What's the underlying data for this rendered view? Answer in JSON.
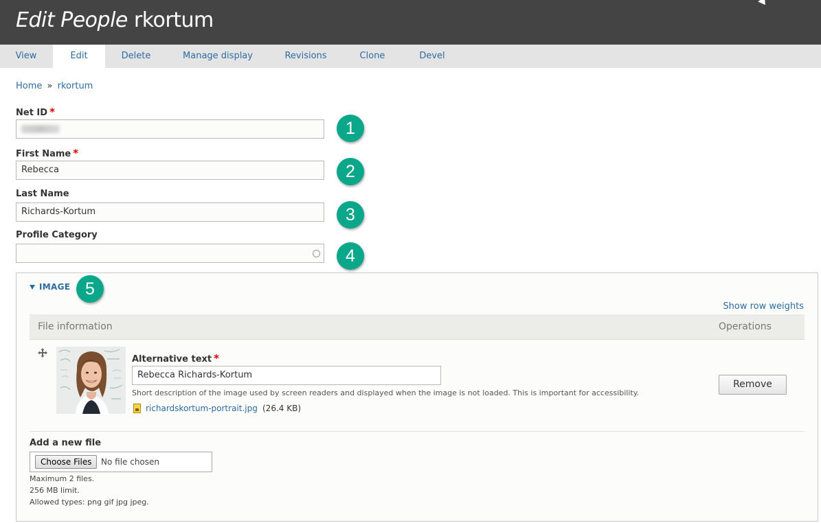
{
  "header": {
    "title_em": "Edit People",
    "title_name": "rkortum"
  },
  "tabs": [
    {
      "label": "View"
    },
    {
      "label": "Edit",
      "active": true
    },
    {
      "label": "Delete"
    },
    {
      "label": "Manage display"
    },
    {
      "label": "Revisions"
    },
    {
      "label": "Clone"
    },
    {
      "label": "Devel"
    }
  ],
  "breadcrumb": {
    "home": "Home",
    "separator": "»",
    "current": "rkortum"
  },
  "form": {
    "net_id": {
      "label": "Net ID",
      "required": "*"
    },
    "first_name": {
      "label": "First Name",
      "required": "*",
      "value": "Rebecca"
    },
    "last_name": {
      "label": "Last Name",
      "value": "Richards-Kortum"
    },
    "profile_category": {
      "label": "Profile Category",
      "value": ""
    }
  },
  "badges": [
    "1",
    "2",
    "3",
    "4",
    "5"
  ],
  "image_section": {
    "legend": "IMAGE",
    "show_row_weights": "Show row weights",
    "columns": [
      "File information",
      "Operations"
    ],
    "row": {
      "alt_label": "Alternative text",
      "alt_required": "*",
      "alt_value": "Rebecca Richards-Kortum",
      "alt_description": "Short description of the image used by screen readers and displayed when the image is not loaded. This is important for accessibility.",
      "file_name": "richardskortum-portrait.jpg",
      "file_size": "(26.4 KB)",
      "remove_label": "Remove"
    },
    "add_file": {
      "label": "Add a new file",
      "choose_label": "Choose Files",
      "no_file": "No file chosen",
      "help": [
        "Maximum 2 files.",
        "256 MB limit.",
        "Allowed types: png gif jpg jpeg."
      ]
    }
  },
  "colors": {
    "header_bg": "#444444",
    "link": "#2d6ca2",
    "badge": "#0aa78a",
    "required": "#dd0000"
  }
}
